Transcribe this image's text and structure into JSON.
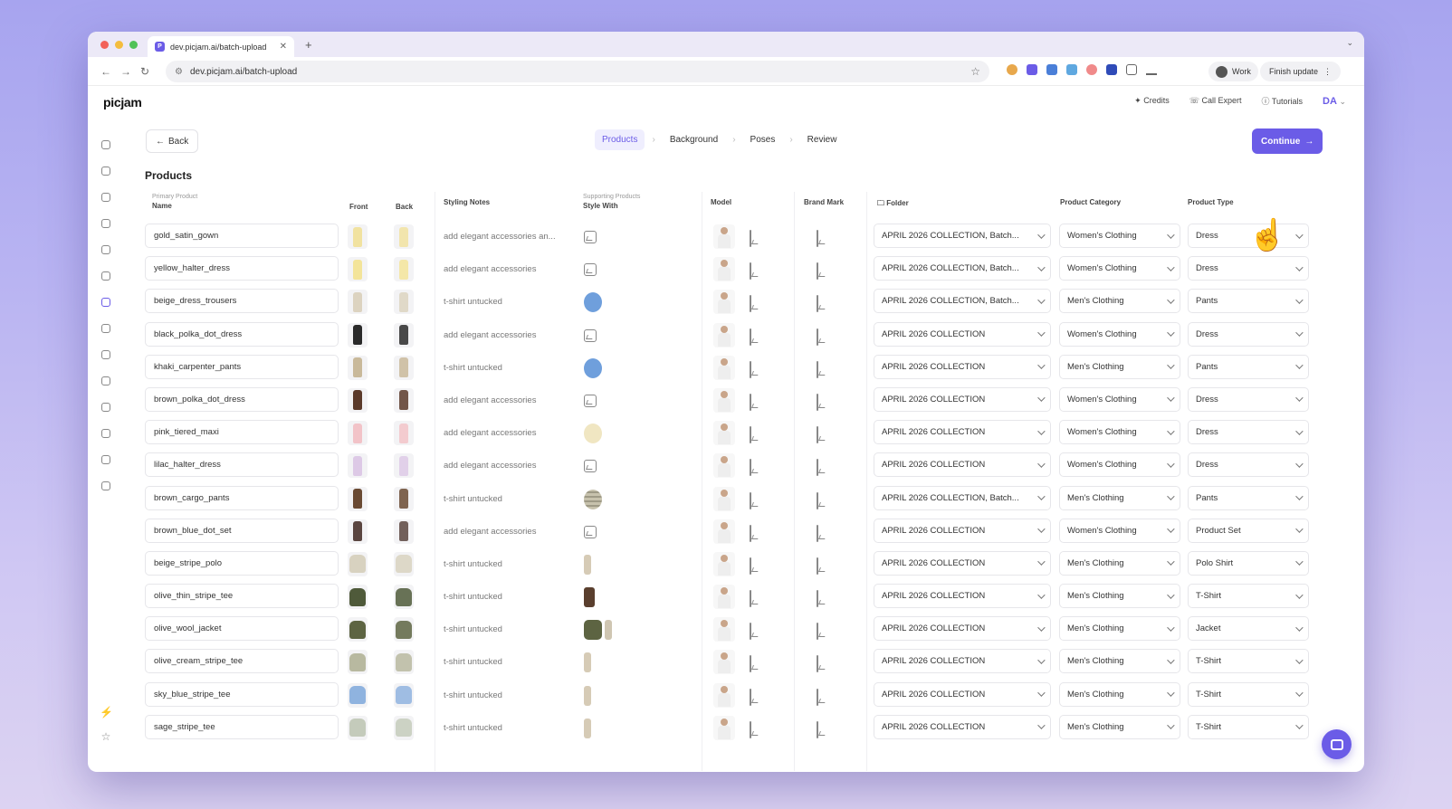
{
  "browser": {
    "tab_title": "dev.picjam.ai/batch-upload",
    "url": "dev.picjam.ai/batch-upload",
    "profile_label": "Work",
    "finish_update_label": "Finish update"
  },
  "app": {
    "logo": "picjam",
    "header": {
      "credits": "Credits",
      "call_expert": "Call Expert",
      "tutorials": "Tutorials",
      "user_initials": "DA"
    },
    "back_label": "Back",
    "steps": [
      "Products",
      "Background",
      "Poses",
      "Review"
    ],
    "active_step": "Products",
    "continue_label": "Continue",
    "section_title": "Products"
  },
  "table": {
    "headers": {
      "name_sub": "Primary Product",
      "name": "Name",
      "front": "Front",
      "back": "Back",
      "styling_notes": "Styling Notes",
      "style_with_sub": "Supporting Products",
      "style_with": "Style With",
      "model": "Model",
      "brand_mark": "Brand Mark",
      "folder": "Folder",
      "product_category": "Product Category",
      "product_type": "Product Type"
    },
    "rows": [
      {
        "name": "gold_satin_gown",
        "notes": "add elegant accessories an...",
        "folder": "APRIL 2026 COLLECTION, Batch...",
        "category": "Women's Clothing",
        "type": "Dress",
        "color": "#f1e2a0",
        "style": "icon"
      },
      {
        "name": "yellow_halter_dress",
        "notes": "add elegant accessories",
        "folder": "APRIL 2026 COLLECTION, Batch...",
        "category": "Women's Clothing",
        "type": "Dress",
        "color": "#f3e49a",
        "style": "icon"
      },
      {
        "name": "beige_dress_trousers",
        "notes": "t-shirt untucked",
        "folder": "APRIL 2026 COLLECTION, Batch...",
        "category": "Men's Clothing",
        "type": "Pants",
        "color": "#dcd3c0",
        "style": "blue-shirt"
      },
      {
        "name": "black_polka_dot_dress",
        "notes": "add elegant accessories",
        "folder": "APRIL 2026 COLLECTION",
        "category": "Women's Clothing",
        "type": "Dress",
        "color": "#2a2a2a",
        "style": "icon"
      },
      {
        "name": "khaki_carpenter_pants",
        "notes": "t-shirt untucked",
        "folder": "APRIL 2026 COLLECTION",
        "category": "Men's Clothing",
        "type": "Pants",
        "color": "#c9b99a",
        "style": "blue-shirt"
      },
      {
        "name": "brown_polka_dot_dress",
        "notes": "add elegant accessories",
        "folder": "APRIL 2026 COLLECTION",
        "category": "Women's Clothing",
        "type": "Dress",
        "color": "#5b3a2a",
        "style": "icon"
      },
      {
        "name": "pink_tiered_maxi",
        "notes": "add elegant accessories",
        "folder": "APRIL 2026 COLLECTION",
        "category": "Women's Clothing",
        "type": "Dress",
        "color": "#f2c3c8",
        "style": "cream"
      },
      {
        "name": "lilac_halter_dress",
        "notes": "add elegant accessories",
        "folder": "APRIL 2026 COLLECTION",
        "category": "Women's Clothing",
        "type": "Dress",
        "color": "#ddc9e6",
        "style": "icon"
      },
      {
        "name": "brown_cargo_pants",
        "notes": "t-shirt untucked",
        "folder": "APRIL 2026 COLLECTION, Batch...",
        "category": "Men's Clothing",
        "type": "Pants",
        "color": "#6a4a33",
        "style": "stripe-shirt"
      },
      {
        "name": "brown_blue_dot_set",
        "notes": "add elegant accessories",
        "folder": "APRIL 2026 COLLECTION",
        "category": "Women's Clothing",
        "type": "Product Set",
        "color": "#5a4540",
        "style": "icon"
      },
      {
        "name": "beige_stripe_polo",
        "notes": "t-shirt untucked",
        "folder": "APRIL 2026 COLLECTION",
        "category": "Men's Clothing",
        "type": "Polo Shirt",
        "color": "#d8d2c0",
        "style": "beige-pants"
      },
      {
        "name": "olive_thin_stripe_tee",
        "notes": "t-shirt untucked",
        "folder": "APRIL 2026 COLLECTION",
        "category": "Men's Clothing",
        "type": "T-Shirt",
        "color": "#4f5a3a",
        "style": "brown-pants"
      },
      {
        "name": "olive_wool_jacket",
        "notes": "t-shirt untucked",
        "folder": "APRIL 2026 COLLECTION",
        "category": "Men's Clothing",
        "type": "Jacket",
        "color": "#5d6442",
        "style": "jacket-pants"
      },
      {
        "name": "olive_cream_stripe_tee",
        "notes": "t-shirt untucked",
        "folder": "APRIL 2026 COLLECTION",
        "category": "Men's Clothing",
        "type": "T-Shirt",
        "color": "#b8b9a0",
        "style": "beige-pants"
      },
      {
        "name": "sky_blue_stripe_tee",
        "notes": "t-shirt untucked",
        "folder": "APRIL 2026 COLLECTION",
        "category": "Men's Clothing",
        "type": "T-Shirt",
        "color": "#8fb3df",
        "style": "beige-pants"
      },
      {
        "name": "sage_stripe_tee",
        "notes": "t-shirt untucked",
        "folder": "APRIL 2026 COLLECTION",
        "category": "Men's Clothing",
        "type": "T-Shirt",
        "color": "#c4cbbb",
        "style": "beige-pants"
      }
    ]
  },
  "colors": {
    "accent": "#6b5ce7",
    "accent_soft": "#efeefe",
    "traffic_red": "#f2625a",
    "traffic_yellow": "#f4bd3e",
    "traffic_green": "#4fc257"
  }
}
